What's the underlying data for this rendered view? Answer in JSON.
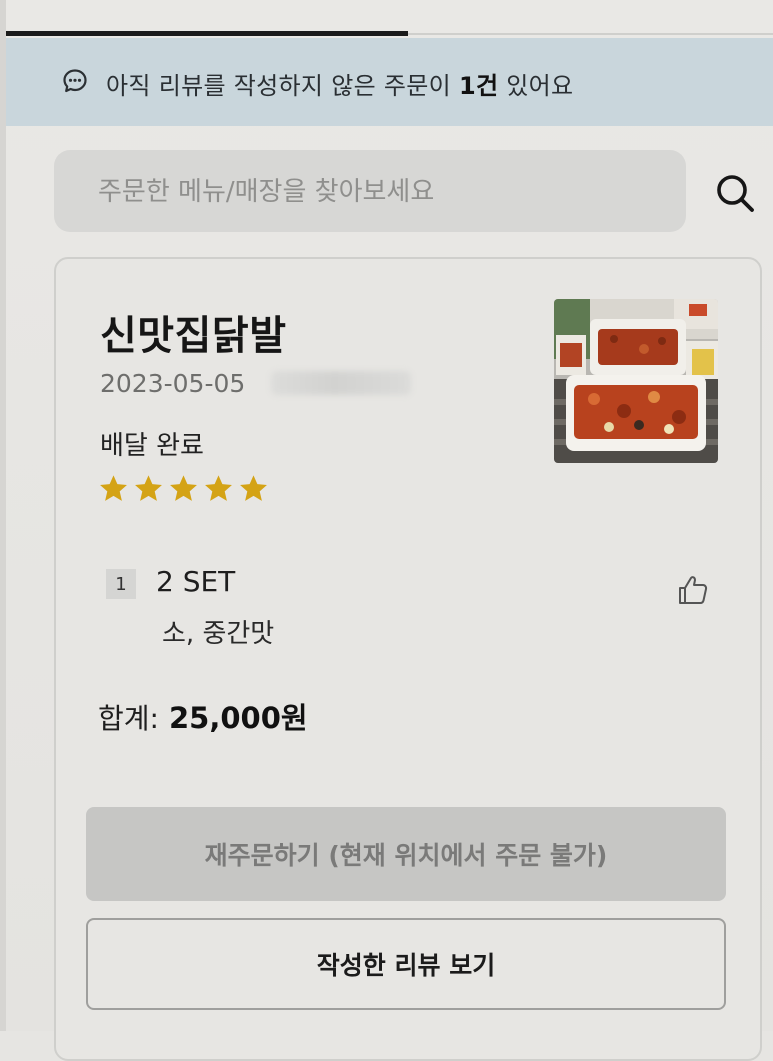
{
  "notice": {
    "prefix": "아직 리뷰를 작성하지 않은 주문이 ",
    "count": "1건",
    "suffix": " 있어요",
    "icon": "chat-bubble-icon"
  },
  "search": {
    "placeholder": "주문한 메뉴/매장을 찾아보세요",
    "value": "",
    "icon": "search-icon"
  },
  "order": {
    "store_name": "신맛집닭발",
    "date": "2023-05-05",
    "status": "배달 완료",
    "rating": 5,
    "star_color": "#d4a315",
    "item": {
      "quantity": "1",
      "name": "2 SET",
      "options": "소, 중간맛"
    },
    "total_label": "합계:",
    "total_amount": "25,000원",
    "like_icon": "thumbs-up-icon",
    "reorder_label": "재주문하기 (현재 위치에서 주문 불가)",
    "view_review_label": "작성한 리뷰 보기"
  },
  "colors": {
    "notice_bg": "#c9d6dc",
    "tab_indicator": "#1b1b1b",
    "disabled_button": "#c6c6c4"
  }
}
